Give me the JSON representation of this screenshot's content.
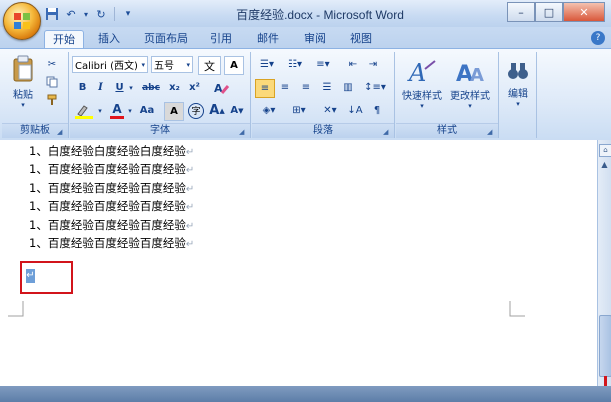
{
  "window": {
    "title": "百度经验.docx - Microsoft Word"
  },
  "tabs": [
    {
      "label": "开始",
      "active": true
    },
    {
      "label": "插入"
    },
    {
      "label": "页面布局"
    },
    {
      "label": "引用"
    },
    {
      "label": "邮件"
    },
    {
      "label": "审阅"
    },
    {
      "label": "视图"
    }
  ],
  "ribbon": {
    "clipboard": {
      "paste_label": "粘贴",
      "group_label": "剪贴板"
    },
    "font": {
      "font_name": "Calibri (西文)",
      "font_size": "五号",
      "group_label": "字体",
      "bold": "B",
      "italic": "I",
      "underline": "U",
      "strike": "abc",
      "subscript": "x₂",
      "superscript": "x²",
      "grow": "A",
      "shrink": "A",
      "clear": "A",
      "textcolor": "A",
      "highlight": "aby",
      "case": "Aa",
      "char_border": "A",
      "phonetic": "文",
      "enclose": "字"
    },
    "paragraph": {
      "group_label": "段落"
    },
    "styles": {
      "quick_label": "快速样式",
      "change_label": "更改样式",
      "group_label": "样式"
    },
    "editing": {
      "label": "编辑"
    }
  },
  "document": {
    "lines": [
      "1、白度经验白度经验白度经验",
      "1、百度经验百度经验百度经验",
      "1、百度经验百度经验百度经验",
      "1、百度经验百度经验百度经验",
      "1、百度经验百度经验百度经验",
      "1、百度经验百度经验百度经验"
    ],
    "para_mark": "↵"
  },
  "colors": {
    "accent": "#15428b",
    "highlight_box": "#d2141b"
  }
}
